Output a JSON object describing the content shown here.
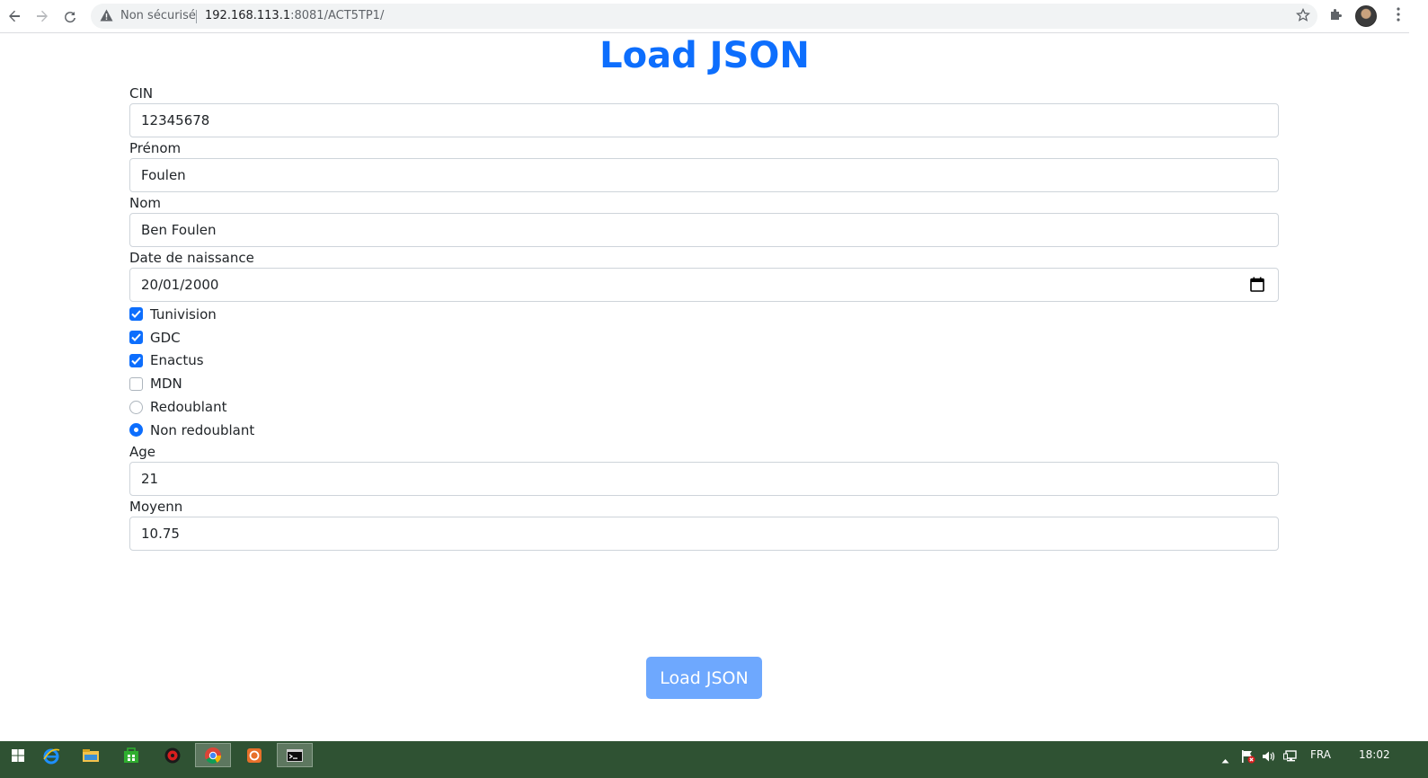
{
  "browser": {
    "security_label": "Non sécurisé",
    "url_host": "192.168.113.1",
    "url_rest": ":8081/ACT5TP1/"
  },
  "page": {
    "title": "Load JSON",
    "fields": {
      "cin": {
        "label": "CIN",
        "value": "12345678"
      },
      "prenom": {
        "label": "Prénom",
        "value": "Foulen"
      },
      "nom": {
        "label": "Nom",
        "value": "Ben Foulen"
      },
      "date": {
        "label": "Date de naissance",
        "value": "20/01/2000"
      },
      "age": {
        "label": "Age",
        "value": "21"
      },
      "moyenne": {
        "label": "Moyenn",
        "value": "10.75"
      }
    },
    "checkboxes": [
      {
        "label": "Tunivision",
        "checked": true
      },
      {
        "label": "GDC",
        "checked": true
      },
      {
        "label": "Enactus",
        "checked": true
      },
      {
        "label": "MDN",
        "checked": false
      }
    ],
    "radios": [
      {
        "label": "Redoublant",
        "checked": false
      },
      {
        "label": "Non redoublant",
        "checked": true
      }
    ],
    "button_label": "Load JSON",
    "accent_color": "#0d6efd",
    "button_color": "#6ea8fe"
  },
  "taskbar": {
    "language": "FRA",
    "clock": "18:02",
    "color": "#2f5233"
  }
}
